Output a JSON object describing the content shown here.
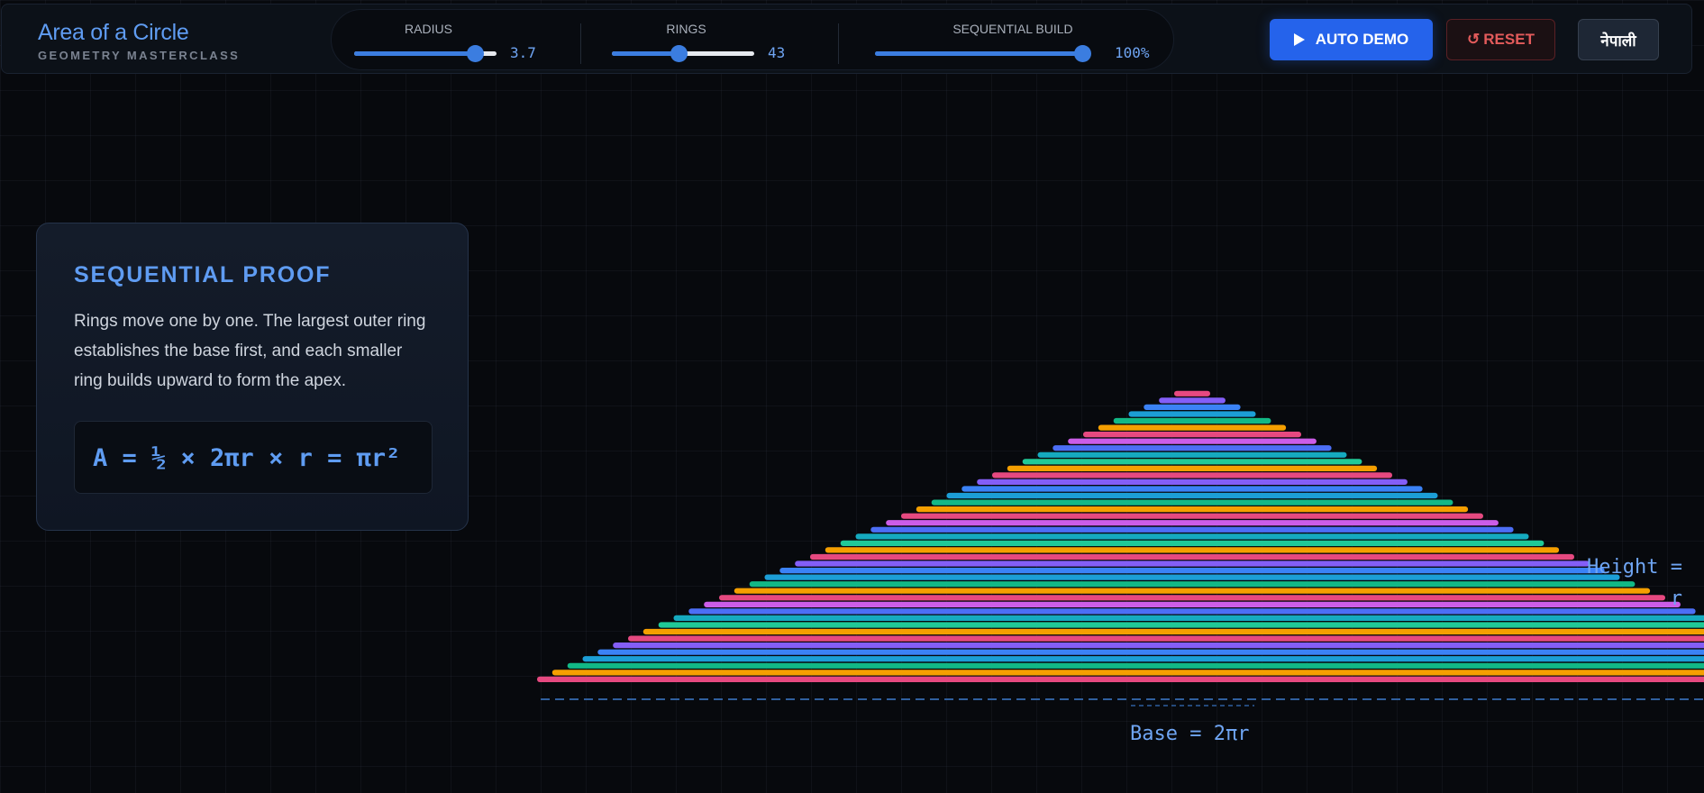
{
  "app": {
    "title": "Area of a Circle",
    "subtitle": "GEOMETRY MASTERCLASS"
  },
  "controls": {
    "radius": {
      "label": "RADIUS",
      "value": "3.7",
      "level": 0.85
    },
    "rings": {
      "label": "RINGS",
      "value": "43",
      "level": 0.47
    },
    "sequential": {
      "label": "SEQUENTIAL BUILD",
      "value": "100%",
      "level": 1.0
    }
  },
  "buttons": {
    "auto_demo": "AUTO DEMO",
    "reset": "RESET",
    "reset_glyph": "↺",
    "language": "नेपाली"
  },
  "info_card": {
    "title": "SEQUENTIAL PROOF",
    "text": "Rings move one by one. The largest outer ring establishes the base first, and each smaller ring builds upward to form the apex.",
    "formula": "A = ½ × 2πr × r = πr²"
  },
  "visualization": {
    "height_label": "Height =\nr",
    "base_label": "Base = 2πr",
    "ring_count": 43,
    "ring_colors": [
      "#e64980",
      "#f59f00",
      "#12b886",
      "#1c9ed6",
      "#3b82f6",
      "#845ef7",
      "#e64980",
      "#f59f00",
      "#20c997",
      "#15aabf",
      "#4c6ef5",
      "#cc5de8"
    ],
    "accent": "#5f9cf2"
  }
}
